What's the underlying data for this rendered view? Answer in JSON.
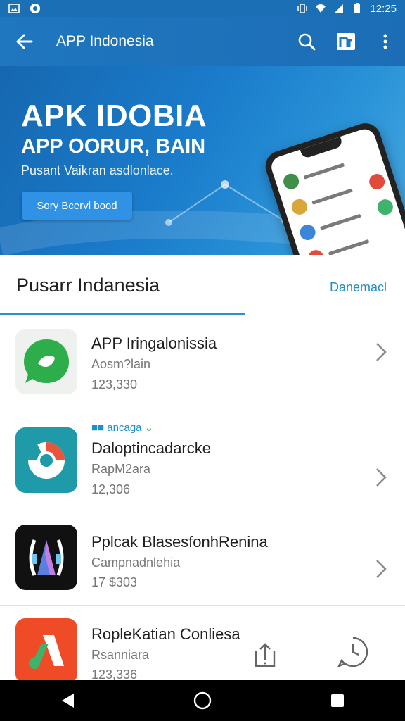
{
  "status_bar": {
    "time": "12:25"
  },
  "app_bar": {
    "title": "APP Indonesia"
  },
  "banner": {
    "headline": "APK IDOBIA",
    "subheadline": "APP OORUR, BAIN",
    "tagline": "Pusant Vaikran asdlonlace.",
    "button_label": "Sory Bcervl bood"
  },
  "section": {
    "title": "Pusarr Indanesia",
    "link_label": "Danemacl"
  },
  "apps": [
    {
      "name": "APP Iringalonissia",
      "subtitle": "Aosm?lain",
      "count": "123,330"
    },
    {
      "badge": "■■ ancaga",
      "name": "Daloptincadarcke",
      "subtitle": "RapM2ara",
      "count": "12,306"
    },
    {
      "name": "Pplcak BlasesfonhRenina",
      "subtitle": "Campnadnlehia",
      "count": "17 $303"
    },
    {
      "name": "RopleKatian Conliesa",
      "subtitle": "Rsanniara",
      "count": "123,336"
    }
  ],
  "colors": {
    "primary": "#1f77bf",
    "accent": "#2b8fd6",
    "link": "#1f8fc9"
  }
}
